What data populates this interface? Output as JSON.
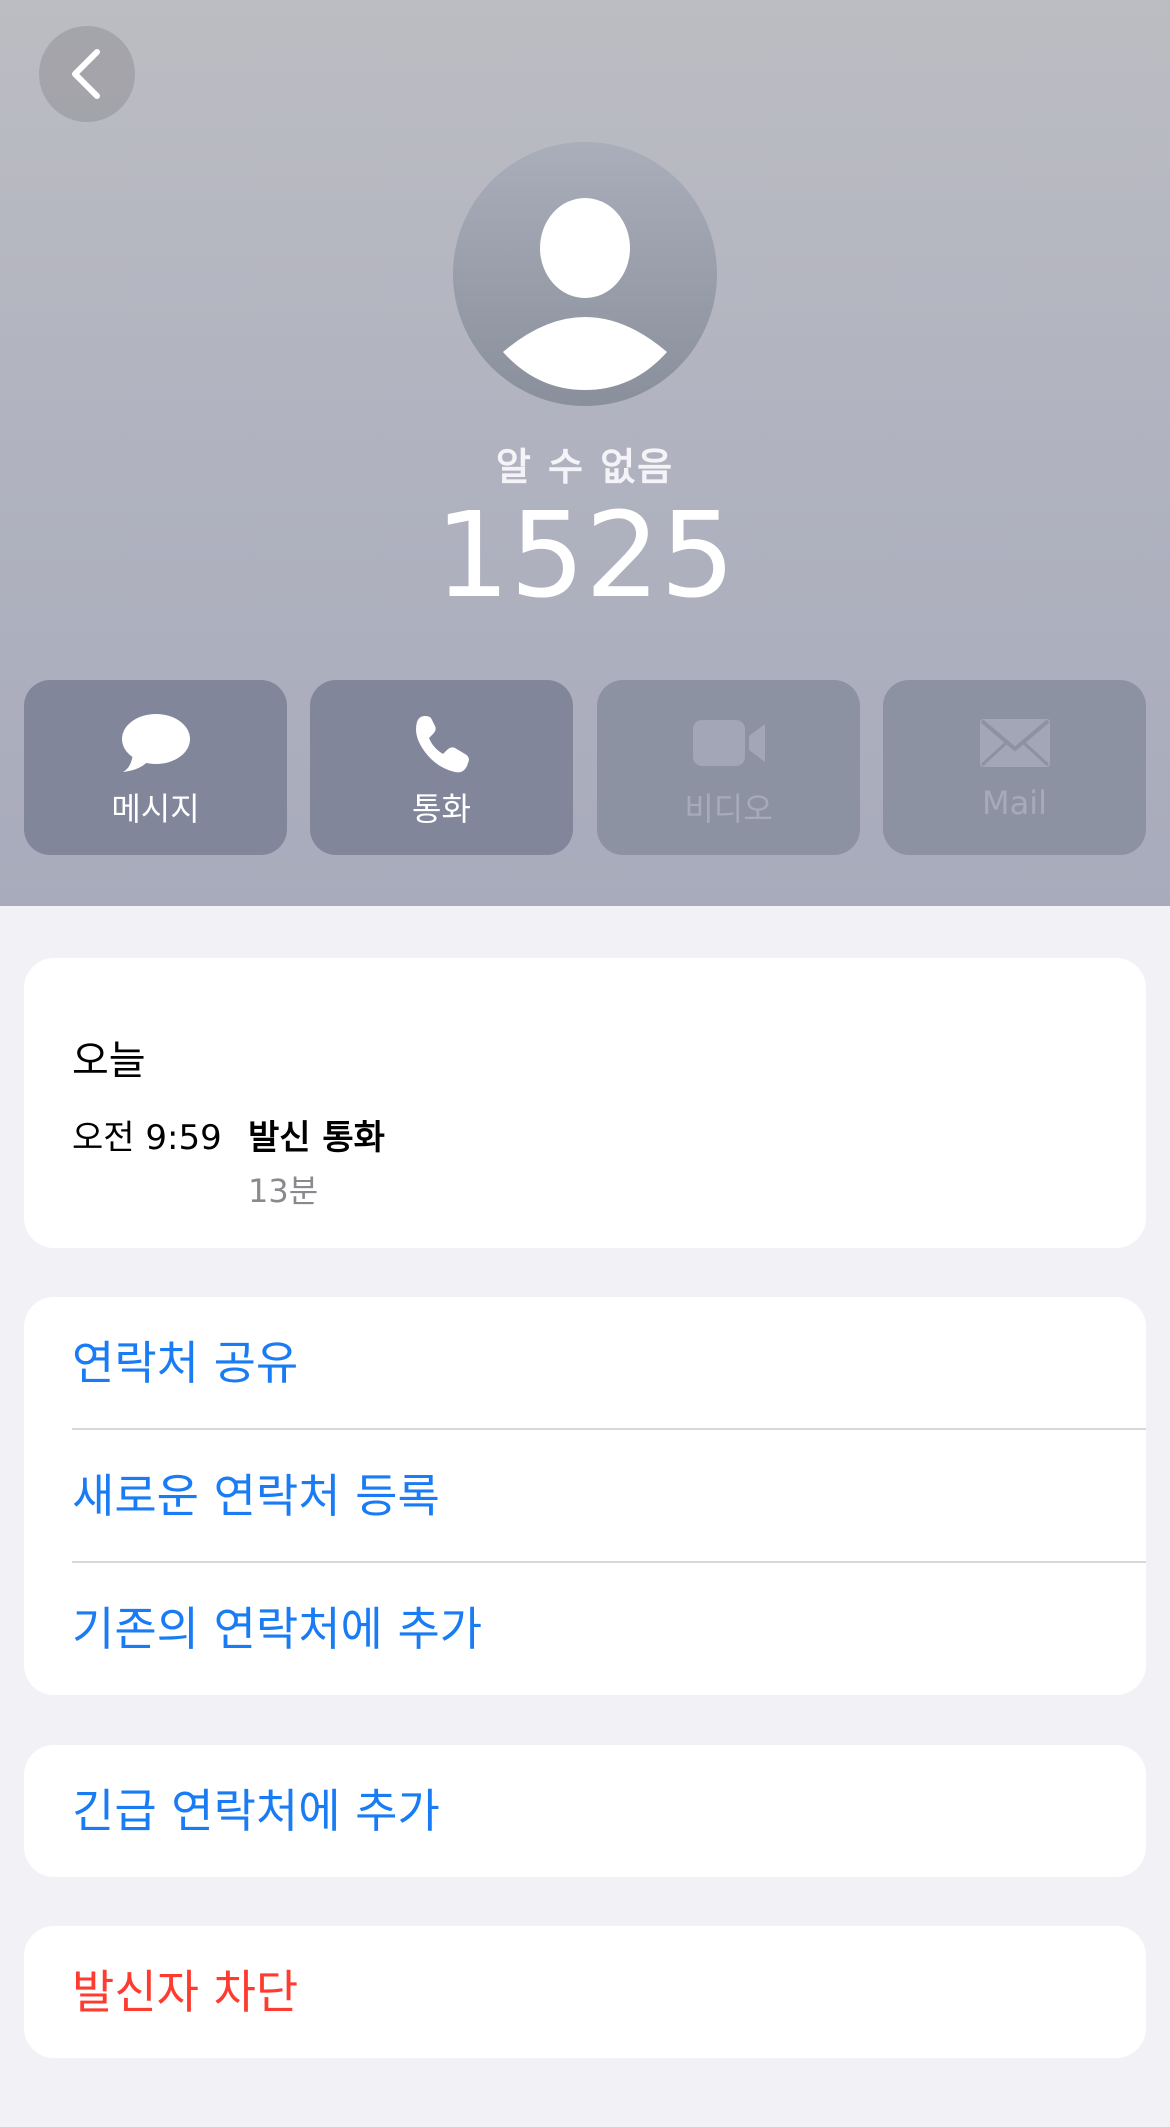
{
  "header": {
    "caller_label": "알 수 없음",
    "caller_number": "1525"
  },
  "actions": [
    {
      "label": "메시지",
      "icon": "message-bubble-icon",
      "enabled": true
    },
    {
      "label": "통화",
      "icon": "phone-icon",
      "enabled": true
    },
    {
      "label": "비디오",
      "icon": "video-camera-icon",
      "enabled": false
    },
    {
      "label": "Mail",
      "icon": "envelope-icon",
      "enabled": false
    }
  ],
  "recents": {
    "day": "오늘",
    "time": "오전 9:59",
    "type": "발신 통화",
    "duration": "13분"
  },
  "contact_options": [
    {
      "label": "연락처 공유"
    },
    {
      "label": "새로운 연락처 등록"
    },
    {
      "label": "기존의 연락처에 추가"
    }
  ],
  "emergency": {
    "label": "긴급 연락처에 추가"
  },
  "block": {
    "label": "발신자 차단"
  },
  "colors": {
    "accent": "#1a7cf4",
    "destructive": "#ff3b30",
    "background": "#f2f1f6",
    "action_button": "#81869a"
  }
}
